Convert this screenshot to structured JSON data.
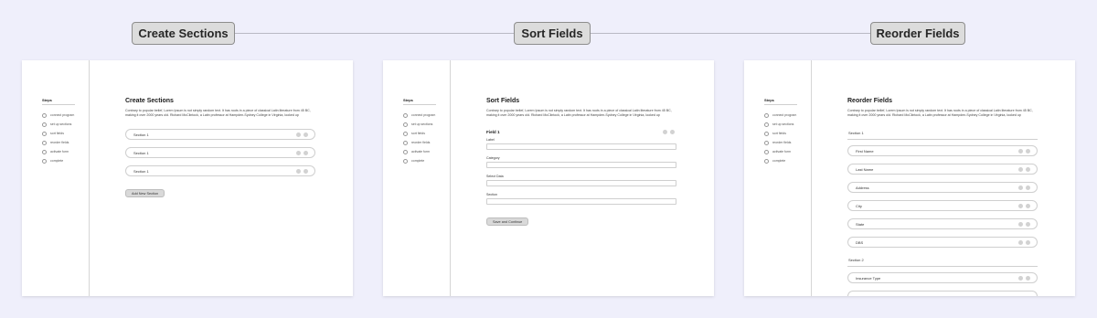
{
  "steps": [
    {
      "tag": "Create Sections"
    },
    {
      "tag": "Sort Fields"
    },
    {
      "tag": "Reorder Fields"
    }
  ],
  "sidebar": {
    "title": "Steps",
    "items": [
      "connect program",
      "set up sections",
      "sort fields",
      "reorder fields",
      "activate form",
      "complete"
    ]
  },
  "description": "Contrary to popular belief, Lorem Ipsum is not simply random text. It has roots in a piece of classical Latin literature from 45 BC, making it over 2000 years old. Richard McClintock, a Latin professor at Hampden-Sydney College in Virginia, looked up",
  "create_sections": {
    "title": "Create Sections",
    "sections": [
      "Section 1",
      "Section 1",
      "Section 1"
    ],
    "add_button": "Add New Section"
  },
  "sort_fields": {
    "title": "Sort Fields",
    "field_title": "Field 1",
    "fields": [
      {
        "label": "Label"
      },
      {
        "label": "Category"
      },
      {
        "label": "Select Data"
      },
      {
        "label": "Section"
      }
    ],
    "save_button": "Save and Continue"
  },
  "reorder_fields": {
    "title": "Reorder Fields",
    "section1": "Section 1",
    "section1_fields": [
      "First Name",
      "Last Name",
      "Address",
      "City",
      "State",
      "DBS"
    ],
    "section2": "Section 2",
    "section2_fields": [
      "Insurance Type"
    ]
  }
}
